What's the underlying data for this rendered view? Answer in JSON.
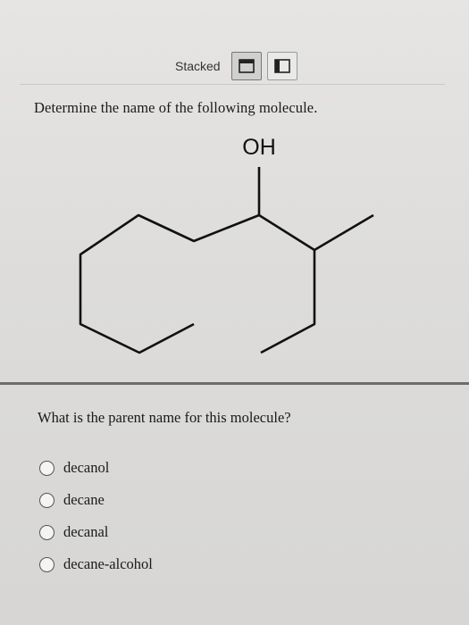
{
  "toolbar": {
    "layout_label": "Stacked"
  },
  "question": {
    "prompt": "Determine the name of the following molecule.",
    "molecule": {
      "substituent_label": "OH"
    },
    "sub_question": "What is the parent name for this molecule?",
    "options": [
      {
        "label": "decanol"
      },
      {
        "label": "decane"
      },
      {
        "label": "decanal"
      },
      {
        "label": "decane-alcohol"
      }
    ]
  }
}
